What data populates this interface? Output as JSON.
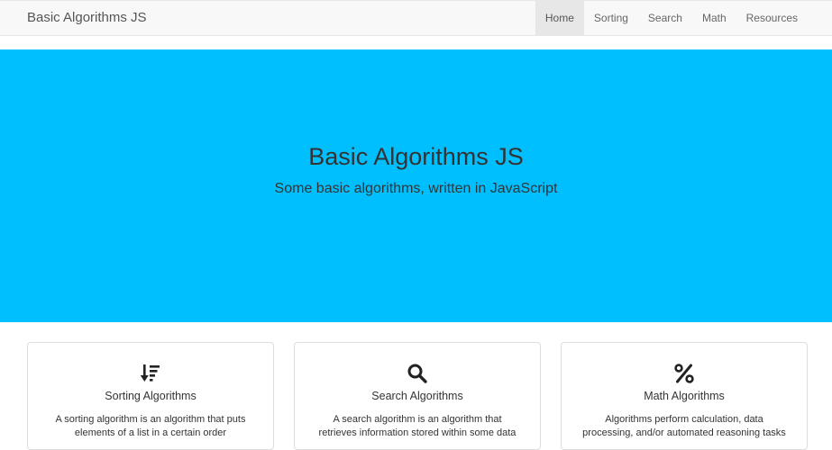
{
  "navbar": {
    "brand": "Basic Algorithms JS",
    "items": [
      {
        "label": "Home",
        "active": true
      },
      {
        "label": "Sorting",
        "active": false
      },
      {
        "label": "Search",
        "active": false
      },
      {
        "label": "Math",
        "active": false
      },
      {
        "label": "Resources",
        "active": false
      }
    ]
  },
  "hero": {
    "title": "Basic Algorithms JS",
    "subtitle": "Some basic algorithms, written in JavaScript",
    "background_color": "#00bfff"
  },
  "cards": [
    {
      "icon": "sort-amount-down-icon",
      "title": "Sorting Algorithms",
      "text": "A sorting algorithm is an algorithm that puts elements of a list in a certain order"
    },
    {
      "icon": "search-icon",
      "title": "Search Algorithms",
      "text": "A search algorithm is an algorithm that retrieves information stored within some data"
    },
    {
      "icon": "percent-icon",
      "title": "Math Algorithms",
      "text": "Algorithms perform calculation, data processing, and/or automated reasoning tasks"
    }
  ]
}
